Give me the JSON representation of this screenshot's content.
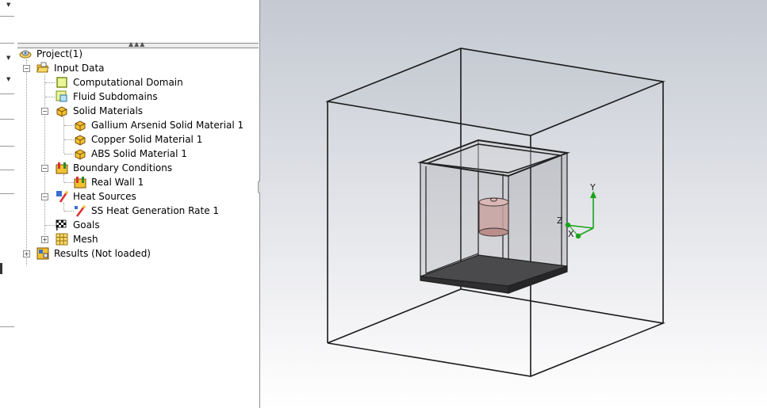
{
  "tree": {
    "root": {
      "label": "Project(1)"
    },
    "input_data": {
      "label": "Input Data"
    },
    "computational_domain": {
      "label": "Computational Domain"
    },
    "fluid_subdomains": {
      "label": "Fluid Subdomains"
    },
    "solid_materials": {
      "label": "Solid Materials",
      "items": [
        {
          "label": "Gallium Arsenid Solid Material 1"
        },
        {
          "label": "Copper Solid Material 1"
        },
        {
          "label": "ABS Solid Material 1"
        }
      ]
    },
    "boundary_conditions": {
      "label": "Boundary Conditions",
      "items": [
        {
          "label": "Real Wall 1"
        }
      ]
    },
    "heat_sources": {
      "label": "Heat Sources",
      "items": [
        {
          "label": "SS Heat Generation Rate 1"
        }
      ]
    },
    "goals": {
      "label": "Goals"
    },
    "mesh": {
      "label": "Mesh"
    },
    "results": {
      "label": "Results (Not loaded)"
    }
  },
  "triad": {
    "x": "X",
    "y": "Y",
    "z": "Z"
  },
  "colors": {
    "axis_green": "#1aa31a",
    "folder_yellow": "#f2c230",
    "material_brown": "#b07a2a",
    "cylinder_pink": "#c9a3a0"
  }
}
